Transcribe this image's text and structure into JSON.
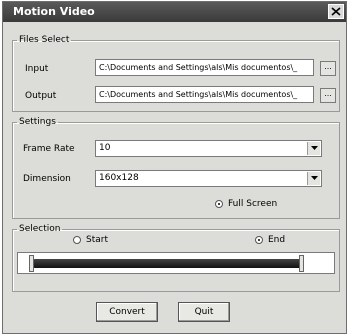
{
  "window": {
    "title": "Motion Video"
  },
  "files_select": {
    "legend": "Files Select",
    "input_label": "Input",
    "input_value": "C:\\Documents and Settings\\als\\Mis documentos\\_",
    "output_label": "Output",
    "output_value": "C:\\Documents and Settings\\als\\Mis documentos\\_",
    "browse_label": "..."
  },
  "settings": {
    "legend": "Settings",
    "frame_rate_label": "Frame Rate",
    "frame_rate_value": "10",
    "dimension_label": "Dimension",
    "dimension_value": "160x128",
    "full_screen_label": "Full Screen",
    "full_screen_selected": true
  },
  "selection": {
    "legend": "Selection",
    "start_label": "Start",
    "start_selected": false,
    "end_label": "End",
    "end_selected": true
  },
  "buttons": {
    "convert_label": "Convert",
    "quit_label": "Quit"
  },
  "icons": {
    "close": "close-icon",
    "dropdown": "chevron-down-icon"
  }
}
